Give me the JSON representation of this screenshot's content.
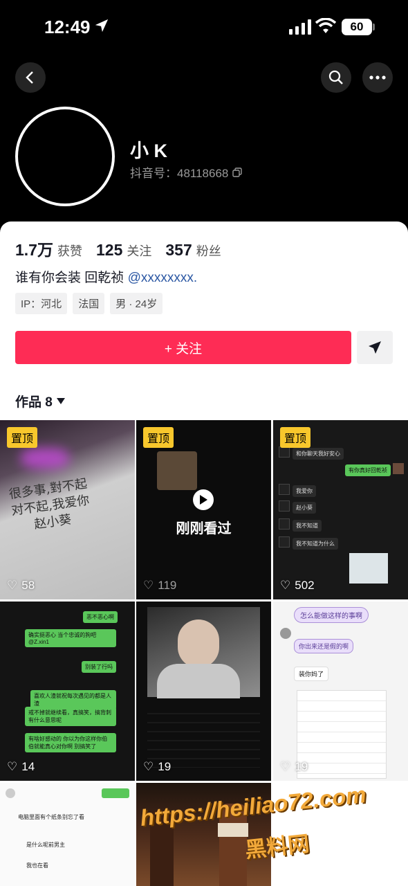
{
  "status_bar": {
    "time": "12:49",
    "battery": "60"
  },
  "profile": {
    "name": "小 K",
    "douyin_id": "抖音号：48118668"
  },
  "stats": [
    {
      "value": "1.7万",
      "label": "获赞"
    },
    {
      "value": "125",
      "label": "关注"
    },
    {
      "value": "357",
      "label": "粉丝"
    }
  ],
  "bio": {
    "text": "谁有你会装 回乾祯 ",
    "mention": "@xxxxxxxx."
  },
  "tags": [
    "IP：河北",
    "法国",
    "男 · 24岁"
  ],
  "follow_button": "+ 关注",
  "works_tab": "作品 8",
  "videos": [
    {
      "pinned": "置顶",
      "likes": "58",
      "caption_lines": [
        "很多事,對不起",
        "对不起,我爱你",
        "赵小葵"
      ]
    },
    {
      "pinned": "置顶",
      "likes": "119",
      "overlay": "刚刚看过"
    },
    {
      "pinned": "置顶",
      "likes": "502",
      "chat": [
        "和你聊天我好安心",
        "有你真好回乾祯",
        "我爱你",
        "赵小葵",
        "我不知道",
        "我不知道为什么"
      ]
    },
    {
      "likes": "14",
      "chat": [
        "恶不恶心啊",
        "确实挺恶心 当个忠诚的狗吧 @Z.xin1",
        "别装了行吗",
        "喜欢人渣就祝每次遇见的都是人渣",
        "戒不掉就继续看，真搞笑，搞背刺有什么意思呢",
        "有啥好感动的 你以为你这样你伯伯就能真心对你啊 别搞笑了"
      ]
    },
    {
      "likes": "19"
    },
    {
      "likes": "19",
      "note_title": "怎么能做这样的事啊",
      "note_lines": [
        "你出来还是假的啊",
        "装你妈了"
      ]
    },
    {
      "comments": [
        "电脑里面有个纸条别忘了看",
        "是什么呢前男主",
        "我也在看"
      ]
    },
    {},
    {}
  ],
  "watermark": {
    "url": "https://heiliao72.com",
    "name": "黑料网"
  },
  "colors": {
    "accent": "#fe2c55",
    "pin": "#f8c72c",
    "chat_green": "#5ac75a"
  }
}
